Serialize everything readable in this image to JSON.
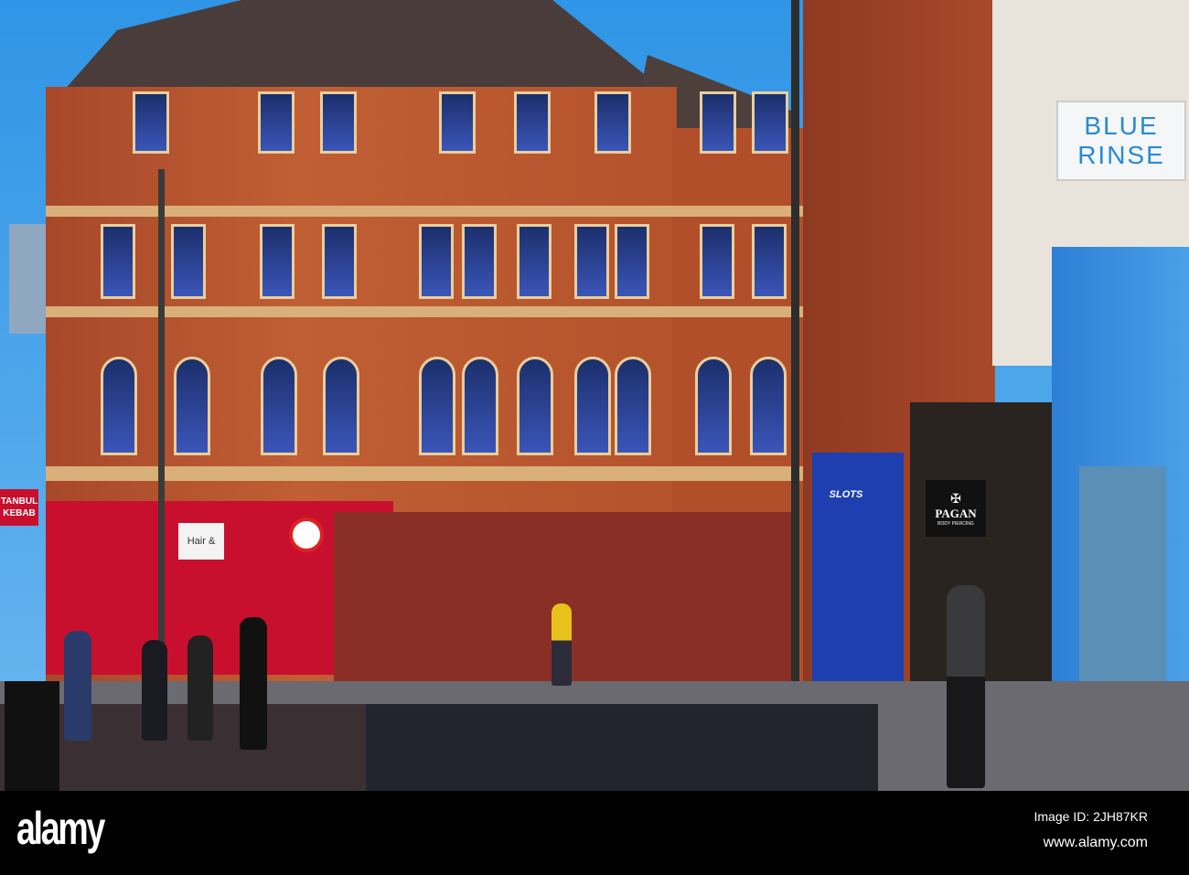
{
  "signs": {
    "blue_rinse": [
      "BLUE",
      "RINSE"
    ],
    "pagan": "PAGAN",
    "pagan_sub": "BODY PIERCING",
    "slots": "SLOTS",
    "kebab": [
      "TANBUL",
      "KEBAB"
    ],
    "hair": "Hair &"
  },
  "watermark": {
    "logo": "alamy",
    "image_id": "Image ID: 2JH87KR",
    "url": "www.alamy.com"
  },
  "colors": {
    "sky": "#3aa0e8",
    "brick": "#b4532c",
    "shopfront_red": "#c8102e",
    "shop_blue": "#2d7fd6"
  }
}
